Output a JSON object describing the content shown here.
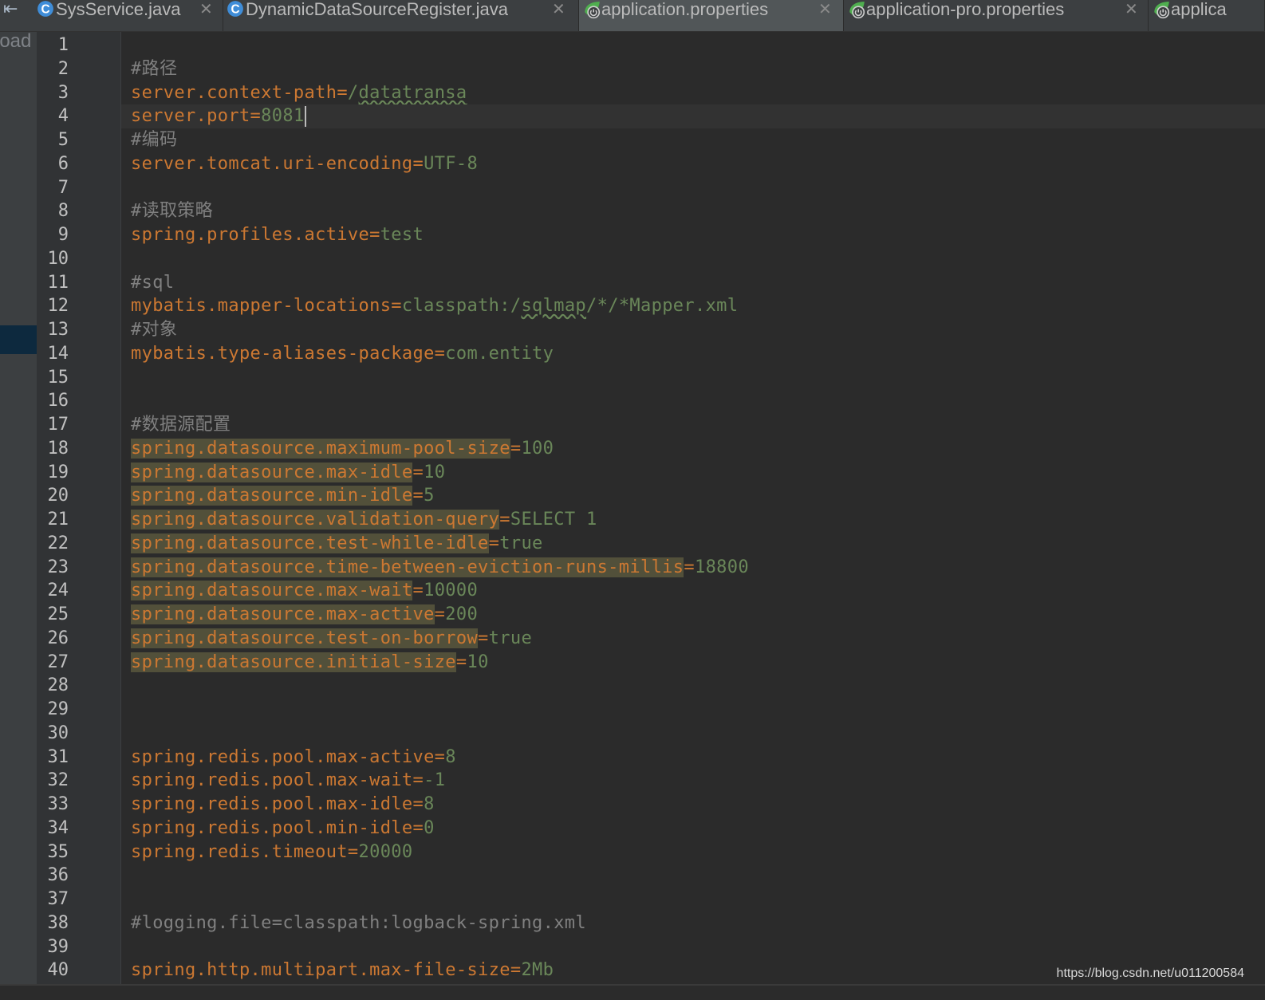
{
  "tabbar": {
    "collapse_glyph": "⇤",
    "tabs": [
      {
        "label": "SysService.java",
        "icon": "class-c-icon",
        "close": "✕",
        "active": false
      },
      {
        "label": "DynamicDataSourceRegister.java",
        "icon": "class-c-icon",
        "close": "✕",
        "active": false
      },
      {
        "label": "application.properties",
        "icon": "spring-properties-icon",
        "close": "✕",
        "active": true
      },
      {
        "label": "application-pro.properties",
        "icon": "spring-properties-icon",
        "close": "✕",
        "active": false
      },
      {
        "label": "applica",
        "icon": "spring-properties-icon",
        "close": "",
        "active": false
      }
    ]
  },
  "left_strip": {
    "label": "load"
  },
  "editor": {
    "current_line": 4,
    "lines": [
      {
        "n": "1",
        "text": ""
      },
      {
        "n": "2",
        "text": "#路径"
      },
      {
        "n": "3",
        "text": "server.context-path=/datatransa"
      },
      {
        "n": "4",
        "text": "server.port=8081"
      },
      {
        "n": "5",
        "text": "#编码"
      },
      {
        "n": "6",
        "text": "server.tomcat.uri-encoding=UTF-8"
      },
      {
        "n": "7",
        "text": ""
      },
      {
        "n": "8",
        "text": "#读取策略"
      },
      {
        "n": "9",
        "text": "spring.profiles.active=test"
      },
      {
        "n": "10",
        "text": ""
      },
      {
        "n": "11",
        "text": "#sql"
      },
      {
        "n": "12",
        "text": "mybatis.mapper-locations=classpath:/sqlmap/*/*Mapper.xml"
      },
      {
        "n": "13",
        "text": "#对象"
      },
      {
        "n": "14",
        "text": "mybatis.type-aliases-package=com.entity"
      },
      {
        "n": "15",
        "text": ""
      },
      {
        "n": "16",
        "text": ""
      },
      {
        "n": "17",
        "text": "#数据源配置"
      },
      {
        "n": "18",
        "text": "spring.datasource.maximum-pool-size=100",
        "hl": true
      },
      {
        "n": "19",
        "text": "spring.datasource.max-idle=10",
        "hl": true
      },
      {
        "n": "20",
        "text": "spring.datasource.min-idle=5",
        "hl": true
      },
      {
        "n": "21",
        "text": "spring.datasource.validation-query=SELECT 1",
        "hl": true
      },
      {
        "n": "22",
        "text": "spring.datasource.test-while-idle=true",
        "hl": true
      },
      {
        "n": "23",
        "text": "spring.datasource.time-between-eviction-runs-millis=18800",
        "hl": true
      },
      {
        "n": "24",
        "text": "spring.datasource.max-wait=10000",
        "hl": true
      },
      {
        "n": "25",
        "text": "spring.datasource.max-active=200",
        "hl": true
      },
      {
        "n": "26",
        "text": "spring.datasource.test-on-borrow=true",
        "hl": true
      },
      {
        "n": "27",
        "text": "spring.datasource.initial-size=10",
        "hl": true
      },
      {
        "n": "28",
        "text": ""
      },
      {
        "n": "29",
        "text": ""
      },
      {
        "n": "30",
        "text": ""
      },
      {
        "n": "31",
        "text": "spring.redis.pool.max-active=8"
      },
      {
        "n": "32",
        "text": "spring.redis.pool.max-wait=-1"
      },
      {
        "n": "33",
        "text": "spring.redis.pool.max-idle=8"
      },
      {
        "n": "34",
        "text": "spring.redis.pool.min-idle=0"
      },
      {
        "n": "35",
        "text": "spring.redis.timeout=20000"
      },
      {
        "n": "36",
        "text": ""
      },
      {
        "n": "37",
        "text": ""
      },
      {
        "n": "38",
        "text": "#logging.file=classpath:logback-spring.xml"
      },
      {
        "n": "39",
        "text": ""
      },
      {
        "n": "40",
        "text": "spring.http.multipart.max-file-size=2Mb"
      }
    ]
  },
  "footer": {
    "watermark": "https://blog.csdn.net/u011200584"
  },
  "colors": {
    "key": "#cc7832",
    "value": "#6a8759",
    "comment": "#808080",
    "highlight": "#52503a",
    "background": "#2b2b2b"
  }
}
